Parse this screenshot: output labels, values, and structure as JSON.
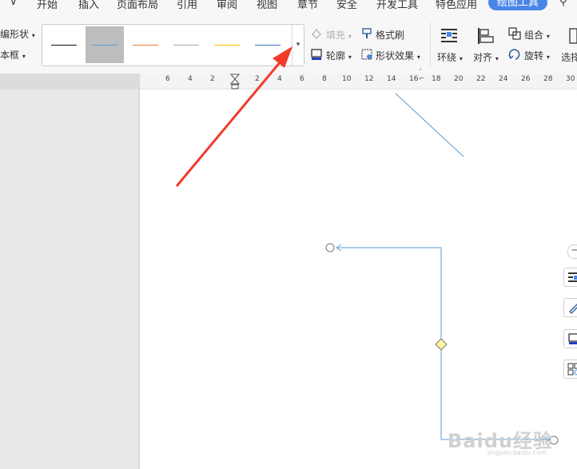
{
  "menu": {
    "items": [
      "开始",
      "插入",
      "页面布局",
      "引用",
      "审阅",
      "视图",
      "章节",
      "安全",
      "开发工具",
      "特色应用"
    ],
    "active_tab": "绘图工具"
  },
  "ribbon": {
    "left_cut": [
      "编形状",
      "本框"
    ],
    "fill_label": "填充",
    "format_painter_label": "格式刷",
    "outline_label": "轮廓",
    "shape_effect_label": "形状效果",
    "wrap_label": "环绕",
    "align_label": "对齐",
    "group_label": "组合",
    "rotate_label": "旋转",
    "select_label": "选择"
  },
  "line_styles": [
    {
      "color": "#111111"
    },
    {
      "color": "#5b9bd5"
    },
    {
      "color": "#ed7d31"
    },
    {
      "color": "#a5a5a5"
    },
    {
      "color": "#ffc000"
    },
    {
      "color": "#4472c4"
    }
  ],
  "ruler": {
    "numbers": [
      "6",
      "4",
      "2",
      "2",
      "4",
      "6",
      "8",
      "10",
      "12",
      "14",
      "16",
      "18",
      "20",
      "22",
      "24",
      "26",
      "28",
      "30"
    ]
  },
  "watermark": {
    "text": "Baidu经验",
    "url": "jingyan.baidu.com"
  }
}
